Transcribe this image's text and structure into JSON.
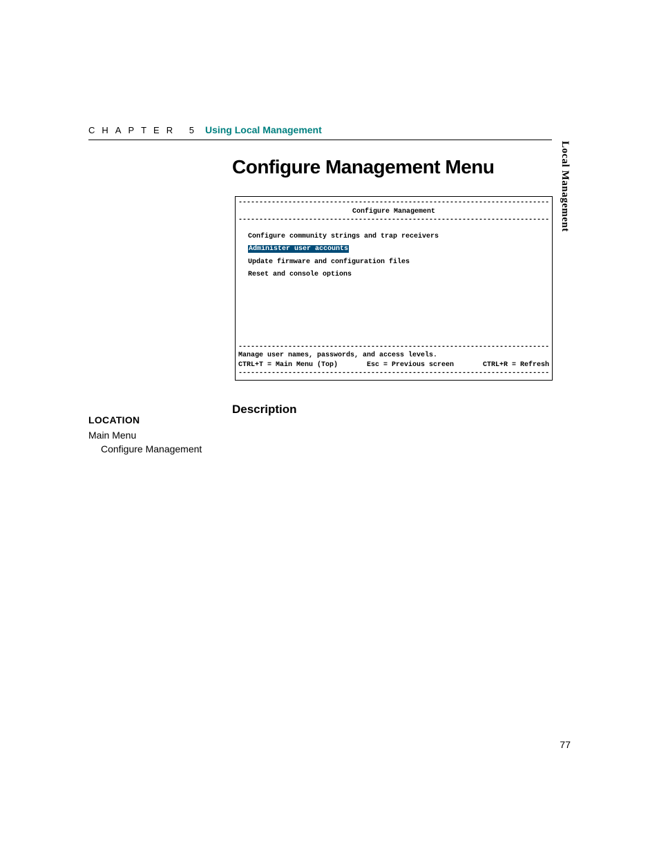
{
  "header": {
    "chapter_label": "CHAPTER 5",
    "chapter_title": "Using Local Management"
  },
  "side_tab": "Local Management",
  "page_title": "Configure Management Menu",
  "terminal": {
    "dashes": "--------------------------------------------------------------------------------",
    "title": "Configure Management",
    "menu_items": {
      "item0": "Configure community strings and trap receivers",
      "item1": "Administer user accounts",
      "item2": "Update firmware and configuration files",
      "item3": "Reset and console options"
    },
    "status": "Manage user names, passwords, and access levels.",
    "footer": {
      "left": "CTRL+T = Main Menu (Top)",
      "center": "Esc = Previous screen",
      "right": "CTRL+R = Refresh"
    }
  },
  "sections": {
    "description_header": "Description",
    "location_header": "LOCATION",
    "location_path": {
      "level1": "Main Menu",
      "level2": "Configure Management"
    }
  },
  "page_number": "77"
}
